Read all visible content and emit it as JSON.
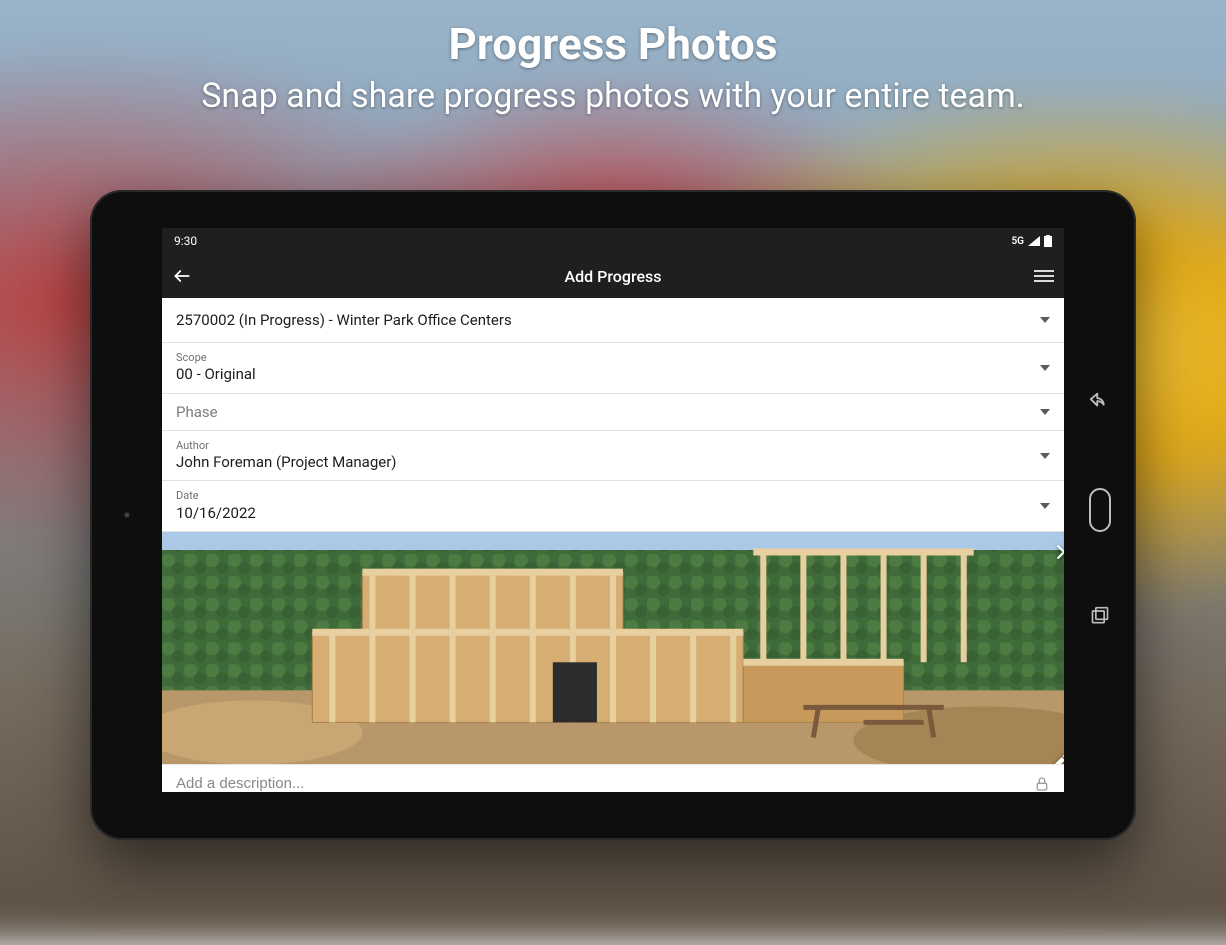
{
  "marketing": {
    "headline": "Progress Photos",
    "subheadline": "Snap and share progress photos with your entire team."
  },
  "statusbar": {
    "time": "9:30",
    "network": "5G"
  },
  "appbar": {
    "title": "Add Progress"
  },
  "form": {
    "project": {
      "value": "2570002 (In Progress) - Winter Park Office Centers"
    },
    "scope": {
      "label": "Scope",
      "value": "00 - Original"
    },
    "phase": {
      "placeholder": "Phase"
    },
    "author": {
      "label": "Author",
      "value": "John Foreman (Project Manager)"
    },
    "date": {
      "label": "Date",
      "value": "10/16/2022"
    },
    "description": {
      "placeholder": "Add a description..."
    }
  },
  "icons": {
    "back": "back-arrow-icon",
    "menu": "hamburger-menu-icon",
    "caret": "caret-down-icon",
    "close": "close-icon",
    "edit": "pencil-icon",
    "lock": "lock-icon",
    "signal": "signal-icon",
    "battery": "battery-icon",
    "nav_back": "system-back-icon",
    "nav_recents": "system-recents-icon"
  }
}
